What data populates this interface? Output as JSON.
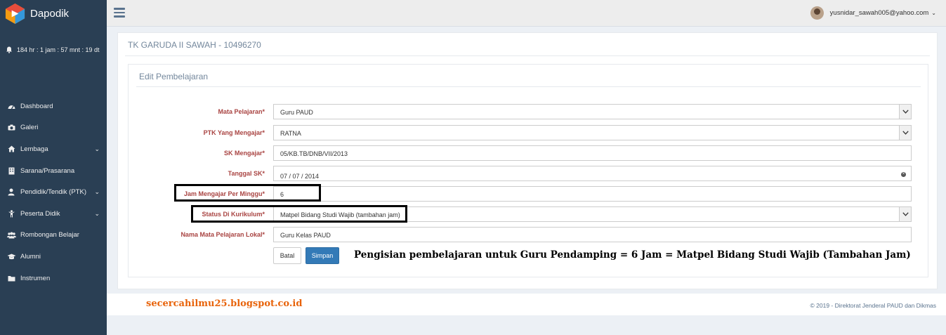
{
  "app": {
    "name": "Dapodik"
  },
  "sidebar": {
    "countdown": "184 hr : 1 jam : 57 mnt : 19 dt",
    "items": [
      {
        "label": "Dashboard",
        "icon": "dashboard-icon",
        "has_submenu": false
      },
      {
        "label": "Galeri",
        "icon": "camera-icon",
        "has_submenu": false
      },
      {
        "label": "Lembaga",
        "icon": "home-icon",
        "has_submenu": true
      },
      {
        "label": "Sarana/Prasarana",
        "icon": "building-icon",
        "has_submenu": false
      },
      {
        "label": "Pendidik/Tendik (PTK)",
        "icon": "user-icon",
        "has_submenu": true
      },
      {
        "label": "Peserta Didik",
        "icon": "child-icon",
        "has_submenu": true
      },
      {
        "label": "Rombongan Belajar",
        "icon": "users-icon",
        "has_submenu": false
      },
      {
        "label": "Alumni",
        "icon": "graduation-cap-icon",
        "has_submenu": false
      },
      {
        "label": "Instrumen",
        "icon": "folder-icon",
        "has_submenu": false
      }
    ]
  },
  "topnav": {
    "user_email": "yusnidar_sawah005@yahoo.com"
  },
  "panel": {
    "title": "TK GARUDA II SAWAH - 10496270"
  },
  "form": {
    "title": "Edit Pembelajaran",
    "mata_pelajaran": {
      "label": "Mata Pelajaran*",
      "value": "Guru PAUD"
    },
    "ptk": {
      "label": "PTK Yang Mengajar*",
      "value": "RATNA"
    },
    "sk": {
      "label": "SK Mengajar*",
      "value": "05/KB.TB/DNB/VII/2013"
    },
    "tanggal_sk": {
      "label": "Tanggal SK*",
      "value": "07 / 07 / 2014"
    },
    "jam": {
      "label": "Jam Mengajar Per Minggu*",
      "value": "6"
    },
    "status": {
      "label": "Status Di Kurikulum*",
      "value": "Matpel Bidang Studi Wajib (tambahan jam)"
    },
    "nama_lokal": {
      "label": "Nama Mata Pelajaran Lokal*",
      "value": "Guru Kelas PAUD"
    },
    "batal_label": "Batal",
    "simpan_label": "Simpan"
  },
  "annotation": "Pengisian pembelajaran untuk Guru Pendamping = 6 Jam = Matpel Bidang Studi Wajib (Tambahan Jam)",
  "footer": {
    "blog": "secercahilmu25.blogspot.co.id",
    "copyright": "©   2019 - Direktorat Jenderal PAUD dan Dikmas"
  },
  "colors": {
    "sidebar_bg": "#2a3f54",
    "label_red": "#a94442",
    "primary_button": "#337ab7",
    "blog_orange": "#e8630a"
  }
}
